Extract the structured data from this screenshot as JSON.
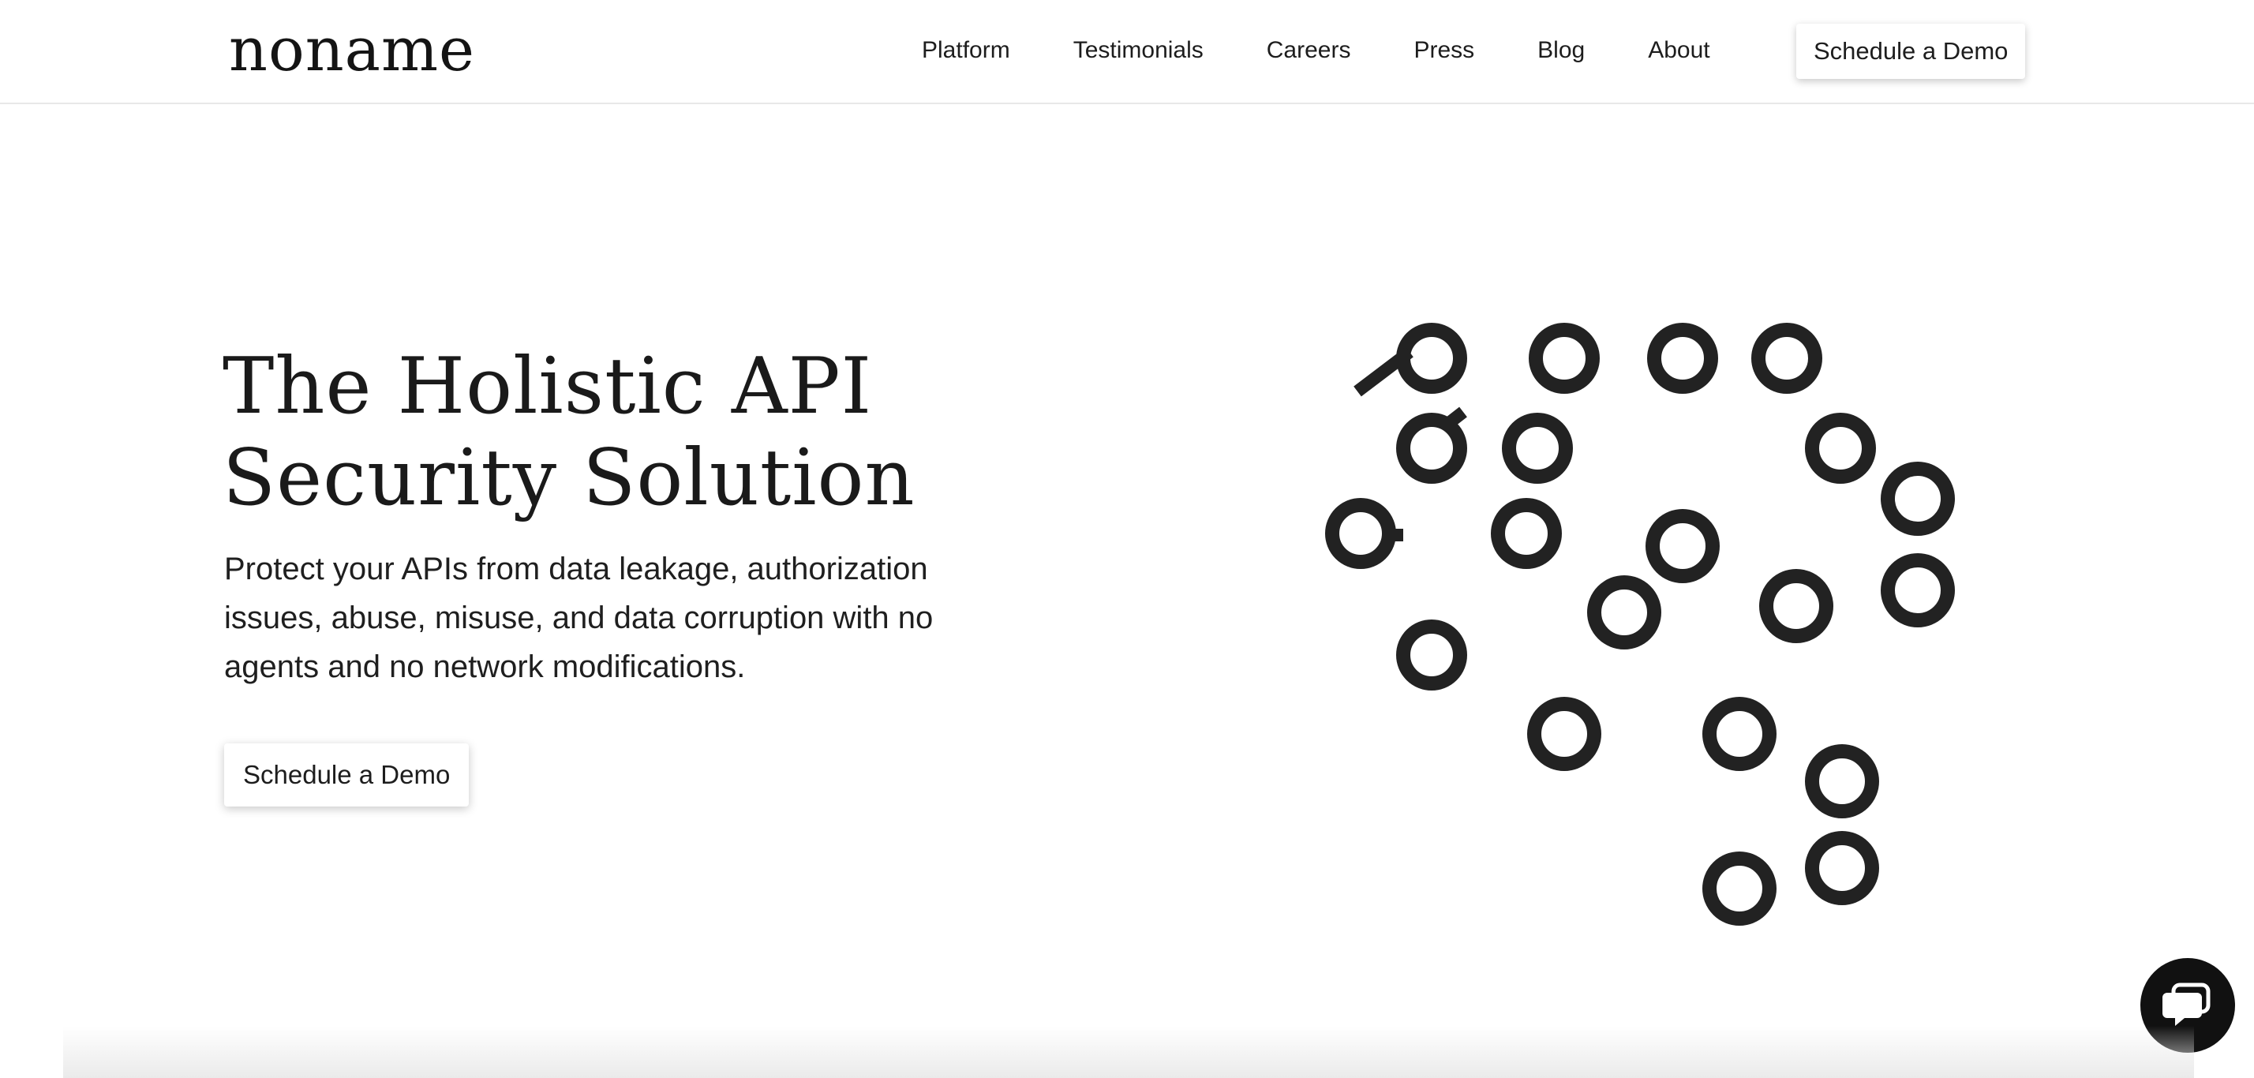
{
  "header": {
    "logo": "noname",
    "nav": [
      {
        "label": "Platform"
      },
      {
        "label": "Testimonials"
      },
      {
        "label": "Careers"
      },
      {
        "label": "Press"
      },
      {
        "label": "Blog"
      },
      {
        "label": "About"
      }
    ],
    "cta_label": "Schedule a Demo"
  },
  "hero": {
    "title_line1": "The Holistic API",
    "title_line2": "Security Solution",
    "subtitle": "Protect your APIs from data leakage, authorization issues, abuse, misuse, and data corruption with no agents and no network modifications.",
    "cta_label": "Schedule a Demo"
  },
  "art": {
    "icon": "ring-dots-illustration-icon",
    "color": "#222222"
  },
  "chat": {
    "icon": "chat-bubble-icon",
    "color": "#111111"
  }
}
